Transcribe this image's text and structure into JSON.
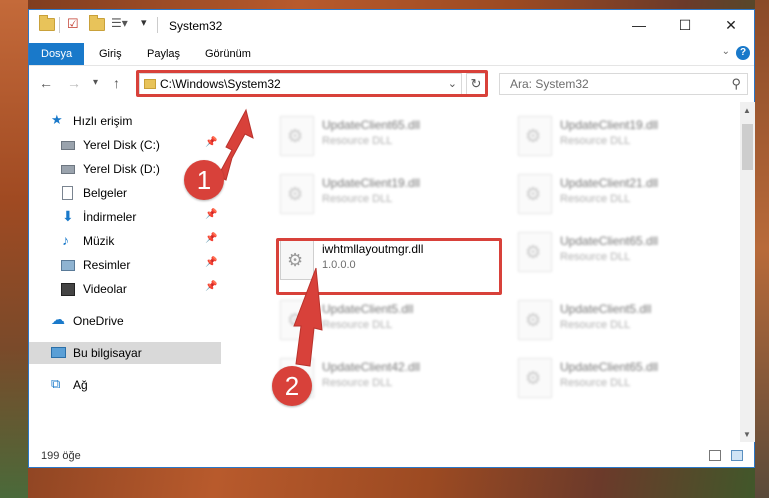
{
  "window": {
    "title": "System32",
    "controls": {
      "minimize": "—",
      "maximize": "☐",
      "close": "✕"
    }
  },
  "ribbon": {
    "tabs": [
      "Dosya",
      "Giriş",
      "Paylaş",
      "Görünüm"
    ],
    "help": "?"
  },
  "address": {
    "path": "C:\\Windows\\System32",
    "search_placeholder": "Ara: System32"
  },
  "nav": {
    "items": [
      {
        "label": "Hızlı erişim",
        "icon": "star-icon"
      },
      {
        "label": "Yerel Disk (C:)",
        "icon": "drive-icon",
        "pinned": true
      },
      {
        "label": "Yerel Disk (D:)",
        "icon": "drive-icon"
      },
      {
        "label": "Belgeler",
        "icon": "documents-icon"
      },
      {
        "label": "İndirmeler",
        "icon": "download-icon",
        "pinned": true
      },
      {
        "label": "Müzik",
        "icon": "music-icon",
        "pinned": true
      },
      {
        "label": "Resimler",
        "icon": "pictures-icon",
        "pinned": true
      },
      {
        "label": "Videolar",
        "icon": "video-icon",
        "pinned": true
      },
      {
        "label": "OneDrive",
        "icon": "cloud-icon"
      },
      {
        "label": "Bu bilgisayar",
        "icon": "computer-icon",
        "selected": true
      },
      {
        "label": "Ağ",
        "icon": "network-icon"
      }
    ]
  },
  "files": [
    {
      "name": "UpdateClient65.dll",
      "desc": "Resource DLL"
    },
    {
      "name": "UpdateClient19.dll",
      "desc": "Resource DLL"
    },
    {
      "name": "UpdateClient19.dll",
      "desc": "Resource DLL"
    },
    {
      "name": "UpdateClient21.dll",
      "desc": "Resource DLL"
    },
    {
      "name": "iwhtmllayoutmgr.dll",
      "desc": "1.0.0.0"
    },
    {
      "name": "UpdateClient65.dll",
      "desc": "Resource DLL"
    },
    {
      "name": "UpdateClient5.dll",
      "desc": "Resource DLL"
    },
    {
      "name": "UpdateClient5.dll",
      "desc": "Resource DLL"
    },
    {
      "name": "UpdateClient42.dll",
      "desc": "Resource DLL"
    },
    {
      "name": "UpdateClient65.dll",
      "desc": "Resource DLL"
    }
  ],
  "status": {
    "count": "199 öğe"
  },
  "callouts": [
    "1",
    "2"
  ],
  "colors": {
    "accent": "#1979ca",
    "highlight": "#d8413a"
  }
}
